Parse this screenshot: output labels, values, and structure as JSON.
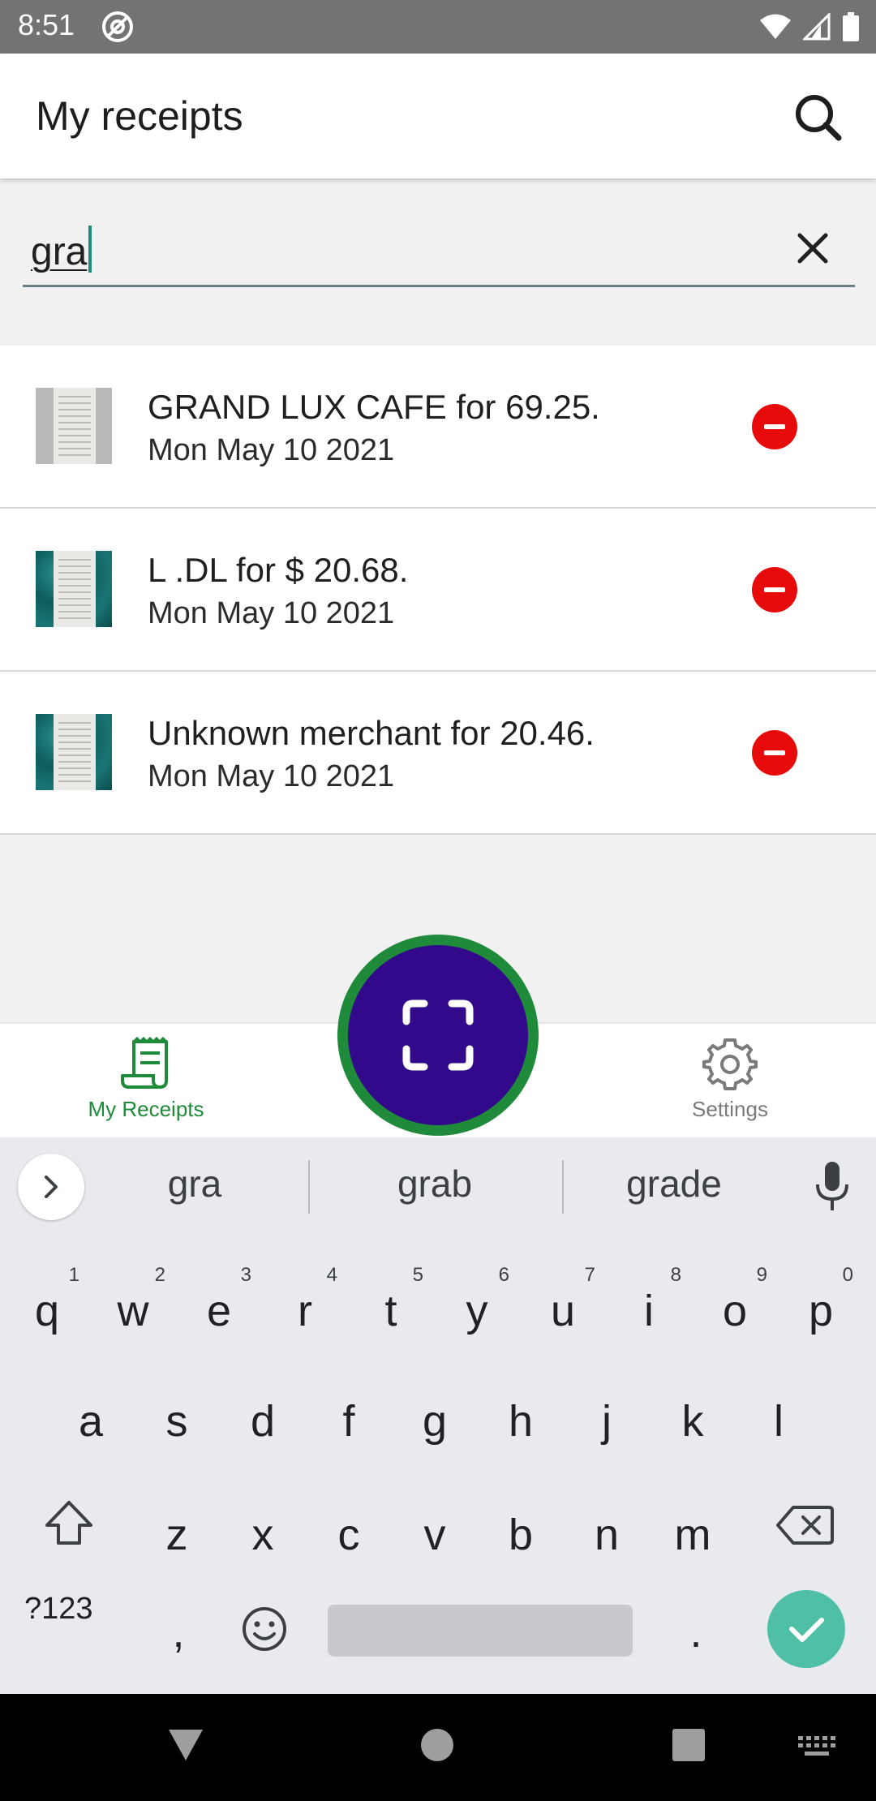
{
  "status_bar": {
    "time": "8:51"
  },
  "app_bar": {
    "title": "My receipts"
  },
  "search": {
    "value": "gra"
  },
  "receipts": [
    {
      "title": "GRAND LUX CAFE for 69.25.",
      "date": "Mon May 10 2021"
    },
    {
      "title": "L .DL for $ 20.68.",
      "date": "Mon May 10 2021"
    },
    {
      "title": "Unknown merchant for 20.46.",
      "date": "Mon May 10 2021"
    }
  ],
  "bottom_nav": {
    "receipts_label": "My Receipts",
    "settings_label": "Settings"
  },
  "suggestions": [
    "gra",
    "grab",
    "grade"
  ],
  "keyboard": {
    "row1": [
      "q",
      "w",
      "e",
      "r",
      "t",
      "y",
      "u",
      "i",
      "o",
      "p"
    ],
    "row1_hints": [
      "1",
      "2",
      "3",
      "4",
      "5",
      "6",
      "7",
      "8",
      "9",
      "0"
    ],
    "row2": [
      "a",
      "s",
      "d",
      "f",
      "g",
      "h",
      "j",
      "k",
      "l"
    ],
    "row3": [
      "z",
      "x",
      "c",
      "v",
      "b",
      "n",
      "m"
    ],
    "symbols_label": "?123",
    "comma": ",",
    "period": "."
  },
  "colors": {
    "accent_green": "#1e8a3a",
    "fab_purple": "#33098c",
    "remove_red": "#e60a0a",
    "enter_teal": "#4fbfa6"
  }
}
